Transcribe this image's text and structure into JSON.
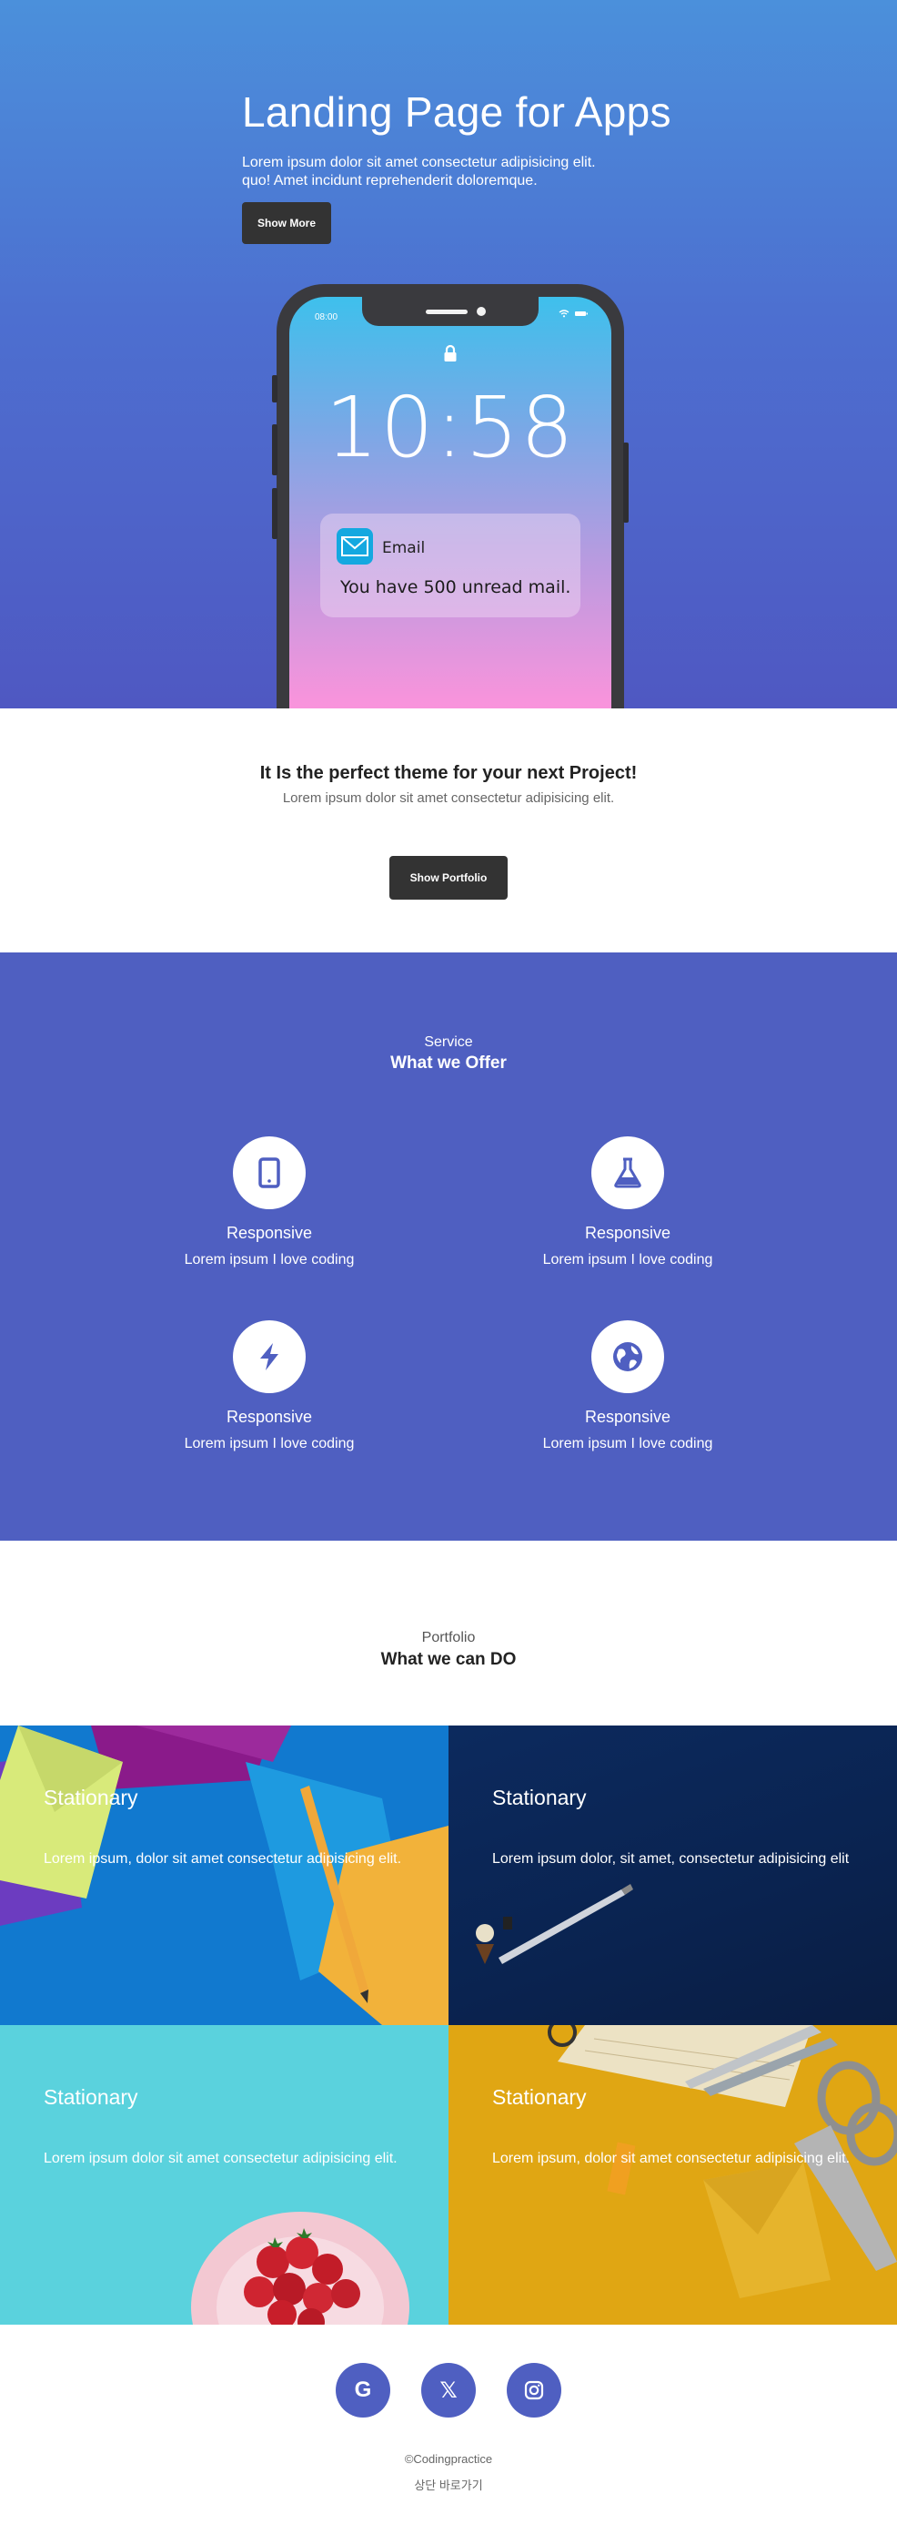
{
  "hero": {
    "title": "Landing Page for Apps",
    "subtitle_line1": "Lorem ipsum dolor sit amet consectetur adipisicing elit.",
    "subtitle_line2": "quo! Amet incidunt reprehenderit doloremque.",
    "button_label": "Show More"
  },
  "phone": {
    "status_time": "08:00",
    "clock": "10:58",
    "notification_app": "Email",
    "notification_message": "You have 500 unread mail."
  },
  "project": {
    "title": "It Is the perfect theme for your next Project!",
    "subtitle": "Lorem ipsum dolor sit amet consectetur adipisicing elit.",
    "button_label": "Show Portfolio"
  },
  "service": {
    "kicker": "Service",
    "title": "What we Offer",
    "items": [
      {
        "icon": "mobile-icon",
        "name": "Responsive",
        "desc": "Lorem ipsum I love coding"
      },
      {
        "icon": "flask-icon",
        "name": "Responsive",
        "desc": "Lorem ipsum I love coding"
      },
      {
        "icon": "bolt-icon",
        "name": "Responsive",
        "desc": "Lorem ipsum I love coding"
      },
      {
        "icon": "globe-icon",
        "name": "Responsive",
        "desc": "Lorem ipsum I love coding"
      }
    ]
  },
  "portfolio": {
    "kicker": "Portfolio",
    "title": "What we can DO",
    "cards": [
      {
        "title": "Stationary",
        "desc": "Lorem ipsum, dolor sit amet consectetur adipisicing elit."
      },
      {
        "title": "Stationary",
        "desc": "Lorem ipsum dolor, sit amet, consectetur adipisicing elit"
      },
      {
        "title": "Stationary",
        "desc": "Lorem ipsum dolor sit amet consectetur adipisicing elit."
      },
      {
        "title": "Stationary",
        "desc": "Lorem ipsum, dolor sit amet consectetur adipisicing elit."
      }
    ]
  },
  "footer": {
    "social": [
      {
        "icon": "google-icon",
        "glyph": "G"
      },
      {
        "icon": "x-twitter-icon",
        "glyph": "𝕏"
      },
      {
        "icon": "instagram-icon",
        "glyph": ""
      }
    ],
    "copyright": "©Codingpractice",
    "back_to_top": "상단 바로가기"
  },
  "colors": {
    "hero_top": "#4b90db",
    "hero_bottom": "#4f58c2",
    "service_bg": "#4f5fc1",
    "button_dark": "#333333",
    "social_bg": "#4f5fc1"
  }
}
